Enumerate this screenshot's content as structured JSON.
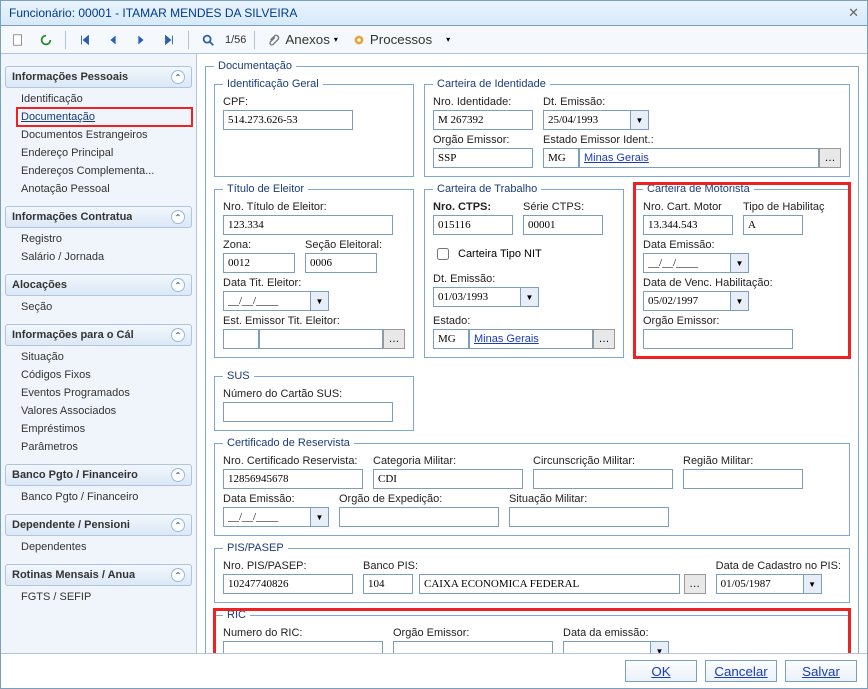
{
  "title": "Funcionário: 00001 - ITAMAR MENDES DA SILVEIRA",
  "toolbar": {
    "pager": "1/56",
    "anexos": "Anexos",
    "processos": "Processos"
  },
  "sidebar": {
    "groups": [
      {
        "label": "Informações Pessoais",
        "items": [
          "Identificação",
          "Documentação",
          "Documentos Estrangeiros",
          "Endereço Principal",
          "Endereços Complementa...",
          "Anotação Pessoal"
        ],
        "selected": 1
      },
      {
        "label": "Informações Contratua",
        "items": [
          "Registro",
          "Salário / Jornada"
        ]
      },
      {
        "label": "Alocações",
        "items": [
          "Seção"
        ]
      },
      {
        "label": "Informações para o Cál",
        "items": [
          "Situação",
          "Códigos Fixos",
          "Eventos Programados",
          "Valores Associados",
          "Empréstimos",
          "Parâmetros"
        ]
      },
      {
        "label": "Banco Pgto / Financeiro",
        "items": [
          "Banco Pgto / Financeiro"
        ]
      },
      {
        "label": "Dependente / Pensioni",
        "items": [
          "Dependentes"
        ]
      },
      {
        "label": "Rotinas Mensais / Anua",
        "items": [
          "FGTS / SEFIP"
        ]
      }
    ]
  },
  "doc": {
    "legend": "Documentação",
    "idgeral": {
      "legend": "Identificação Geral",
      "cpf_label": "CPF:",
      "cpf": "514.273.626-53"
    },
    "identidade": {
      "legend": "Carteira de Identidade",
      "nro_label": "Nro. Identidade:",
      "nro": "M 267392",
      "dtem_label": "Dt. Emissão:",
      "dtem": "25/04/1993",
      "orgao_label": "Orgão Emissor:",
      "orgao": "SSP",
      "estado_label": "Estado Emissor Ident.:",
      "estado_cod": "MG",
      "estado_nome": "Minas Gerais"
    },
    "titulo": {
      "legend": "Título de Eleitor",
      "nro_label": "Nro. Título de Eleitor:",
      "nro": "123.334",
      "zona_label": "Zona:",
      "zona": "0012",
      "secao_label": "Seção Eleitoral:",
      "secao": "0006",
      "data_label": "Data Tit. Eleitor:",
      "data": "__/__/____",
      "est_label": "Est. Emissor Tit. Eleitor:",
      "est_cod": "",
      "est_nome": ""
    },
    "sus": {
      "legend": "SUS",
      "num_label": "Número do Cartão SUS:",
      "num": ""
    },
    "trabalho": {
      "legend": "Carteira de Trabalho",
      "nro_label": "Nro. CTPS:",
      "nro": "015116",
      "serie_label": "Série CTPS:",
      "serie": "00001",
      "nit_label": "Carteira Tipo NIT",
      "dtem_label": "Dt. Emissão:",
      "dtem": "01/03/1993",
      "estado_label": "Estado:",
      "estado_cod": "MG",
      "estado_nome": "Minas Gerais"
    },
    "motorista": {
      "legend": "Carteira de Motorista",
      "nro_label": "Nro. Cart. Motor",
      "nro": "13.344.543",
      "tipo_label": "Tipo de Habilitaç",
      "tipo": "A",
      "dataem_label": "Data Emissão:",
      "dataem": "__/__/____",
      "venc_label": "Data de Venc. Habilitação:",
      "venc": "05/02/1997",
      "orgao_label": "Orgão Emissor:",
      "orgao": ""
    },
    "reservista": {
      "legend": "Certificado de Reservista",
      "nro_label": "Nro. Certificado Reservista:",
      "nro": "12856945678",
      "cat_label": "Categoria Militar:",
      "cat": "CDI",
      "circ_label": "Circunscrição Militar:",
      "circ": "",
      "reg_label": "Região Militar:",
      "reg": "",
      "data_label": "Data Emissão:",
      "data": "__/__/____",
      "orgao_label": "Orgão de Expedição:",
      "orgao": "",
      "sit_label": "Situação Militar:",
      "sit": ""
    },
    "pis": {
      "legend": "PIS/PASEP",
      "nro_label": "Nro. PIS/PASEP:",
      "nro": "10247740826",
      "banco_label": "Banco PIS:",
      "banco_cod": "104",
      "banco_nome": "CAIXA ECONOMICA FEDERAL",
      "data_label": "Data de Cadastro no PIS:",
      "data": "01/05/1987"
    },
    "ric": {
      "legend": "RIC",
      "num_label": "Numero do RIC:",
      "num": "",
      "orgao_label": "Orgão Emissor:",
      "orgao": "",
      "data_label": "Data da emissão:",
      "data": ""
    }
  },
  "footer": {
    "ok": "OK",
    "cancel": "Cancelar",
    "save": "Salvar"
  }
}
